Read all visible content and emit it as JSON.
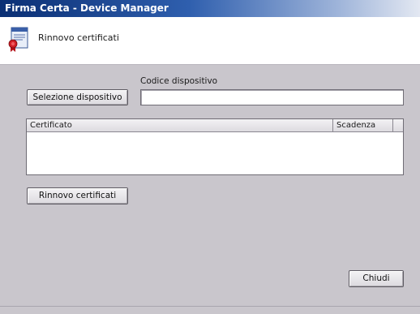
{
  "window": {
    "title": "Firma Certa - Device Manager"
  },
  "header": {
    "title": "Rinnovo certificati",
    "icon": "certificate-document-icon"
  },
  "device": {
    "select_button_label": "Selezione dispositivo",
    "code_label": "Codice dispositivo",
    "code_value": "",
    "code_placeholder": ""
  },
  "certificates_table": {
    "columns": [
      "Certificato",
      "Scadenza"
    ],
    "rows": []
  },
  "actions": {
    "renew_button_label": "Rinnovo certificati",
    "close_button_label": "Chiudi"
  },
  "colors": {
    "window_background": "#c9c6cc",
    "titlebar_start": "#0a2f74",
    "titlebar_end": "#e3e8f2"
  }
}
